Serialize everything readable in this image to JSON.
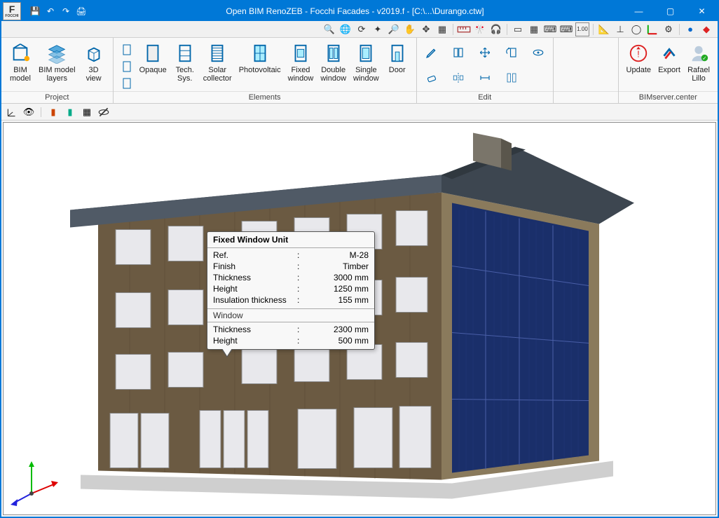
{
  "title": "Open BIM RenoZEB - Focchi Facades - v2019.f - [C:\\...\\Durango.ctw]",
  "logo_text": "FOCCHI",
  "logo_letter": "F",
  "quick_access": [
    "save",
    "undo",
    "redo",
    "print"
  ],
  "window_controls": {
    "min": "—",
    "max": "▢",
    "close": "✕"
  },
  "small_toolbar": [
    "search",
    "globe",
    "refresh",
    "wand",
    "search2",
    "hand",
    "move",
    "copy",
    "sep",
    "ruler",
    "flag",
    "audio",
    "sep",
    "panel",
    "grid",
    "keyboard",
    "keys",
    "scale",
    "sep",
    "angle",
    "perp",
    "circle",
    "axis",
    "gear",
    "sep",
    "blue",
    "help"
  ],
  "ribbon": {
    "groups": [
      {
        "label": "Project",
        "items": [
          {
            "id": "bim-model",
            "label": "BIM\nmodel",
            "icon": "bim-model"
          },
          {
            "id": "bim-layers",
            "label": "BIM model\nlayers",
            "icon": "layers"
          },
          {
            "id": "3d-view",
            "label": "3D\nview",
            "icon": "cube"
          }
        ]
      },
      {
        "label": "Elements",
        "small": [
          {
            "id": "door-sm1",
            "icon": "door-narrow"
          },
          {
            "id": "door-sm2",
            "icon": "door-narrow"
          },
          {
            "id": "door-sm3",
            "icon": "door-narrow"
          }
        ],
        "items": [
          {
            "id": "opaque",
            "label": "Opaque",
            "icon": "opaque"
          },
          {
            "id": "tech-sys",
            "label": "Tech.\nSys.",
            "icon": "tech"
          },
          {
            "id": "solar",
            "label": "Solar\ncollector",
            "icon": "solar"
          },
          {
            "id": "pv",
            "label": "Photovoltaic",
            "icon": "pv"
          },
          {
            "id": "fixed-window",
            "label": "Fixed\nwindow",
            "icon": "fwin"
          },
          {
            "id": "double-window",
            "label": "Double\nwindow",
            "icon": "dwin"
          },
          {
            "id": "single-window",
            "label": "Single\nwindow",
            "icon": "swin"
          },
          {
            "id": "door",
            "label": "Door",
            "icon": "door"
          }
        ]
      },
      {
        "label": "Edit",
        "rows": [
          [
            {
              "id": "edit",
              "icon": "pencil"
            },
            {
              "id": "copy-grp",
              "icon": "copy-grp"
            },
            {
              "id": "move",
              "icon": "move-arrows"
            },
            {
              "id": "rotate",
              "icon": "rotate-box"
            },
            {
              "id": "eye",
              "icon": "eye"
            }
          ],
          [
            {
              "id": "erase",
              "icon": "eraser"
            },
            {
              "id": "mirror",
              "icon": "mirror"
            },
            {
              "id": "measure",
              "icon": "measure"
            },
            {
              "id": "align",
              "icon": "align"
            }
          ]
        ]
      },
      {
        "label": "BIMserver.center",
        "items": [
          {
            "id": "update",
            "label": "Update",
            "icon": "update"
          },
          {
            "id": "export",
            "label": "Export",
            "icon": "export"
          },
          {
            "id": "user",
            "label": "Rafael\nLillo",
            "icon": "user"
          }
        ]
      }
    ]
  },
  "view_toolbar": [
    "axis",
    "eye",
    "sep",
    "color1",
    "color2",
    "grid",
    "eye-off"
  ],
  "tooltip": {
    "title": "Fixed Window Unit",
    "rows": [
      {
        "k": "Ref.",
        "v": "M-28"
      },
      {
        "k": "Finish",
        "v": "Timber"
      },
      {
        "k": "Thickness",
        "v": "3000 mm"
      },
      {
        "k": "Height",
        "v": "1250 mm"
      },
      {
        "k": "Insulation thickness",
        "v": "155 mm"
      }
    ],
    "section": "Window",
    "rows2": [
      {
        "k": "Thickness",
        "v": "2300 mm"
      },
      {
        "k": "Height",
        "v": "500 mm"
      }
    ]
  }
}
